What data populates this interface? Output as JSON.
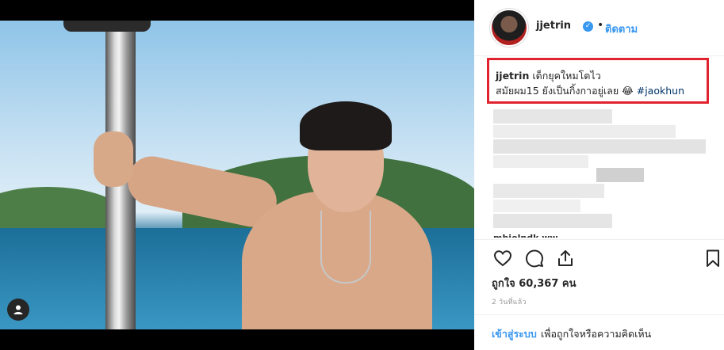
{
  "post": {
    "username": "jjetrin",
    "follow_label": "ติดตาม",
    "separator": "•",
    "verified_icon": "check-badge-icon",
    "caption": {
      "username": "jjetrin",
      "line1": "เด็กยุคใหมโตไว",
      "line2": "สมัยผม15 ยังเป็นกิ้งกาอยู่เลย 😂",
      "hashtag": "#jaokhun"
    },
    "likes_label": "ถูกใจ 60,367 คน",
    "time_ago": "2 วันที่แล้ว",
    "comment_cut_text": "mhiolndk ww"
  },
  "login": {
    "link_label": "เข้าสู่ระบบ",
    "rest_label": "เพื่อถูกใจหรือความคิดเห็น"
  },
  "colors": {
    "accent": "#3897f0",
    "highlight_border": "#e0232e"
  }
}
